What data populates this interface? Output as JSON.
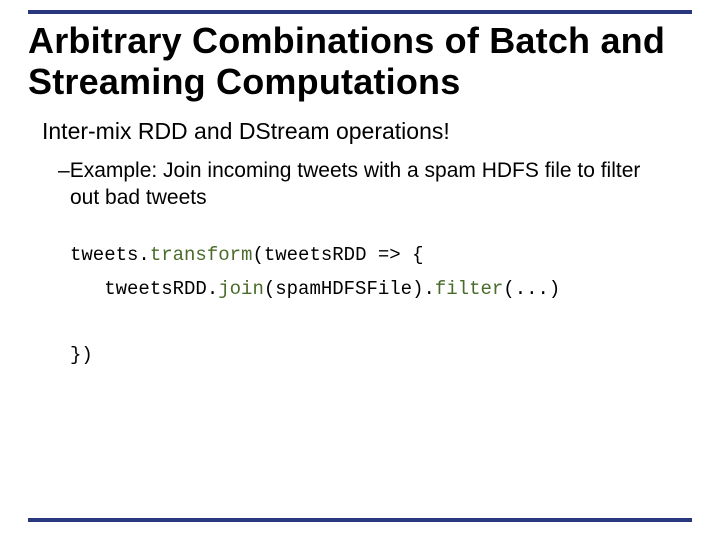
{
  "title": "Arbitrary Combinations of Batch and Streaming Computations",
  "lead": "Inter-mix RDD and DStream operations!",
  "sub_dash": "–",
  "sub_text": "Example: Join incoming tweets with a spam HDFS file to filter out bad tweets",
  "code": {
    "l1a": "tweets.",
    "l1b": "transform",
    "l1c": "(tweetsRDD => {",
    "l2a": "   tweetsRDD.",
    "l2b": "join",
    "l2c": "(spamHDFSFile).",
    "l2d": "filter",
    "l2e": "(...)",
    "l3": "})"
  }
}
